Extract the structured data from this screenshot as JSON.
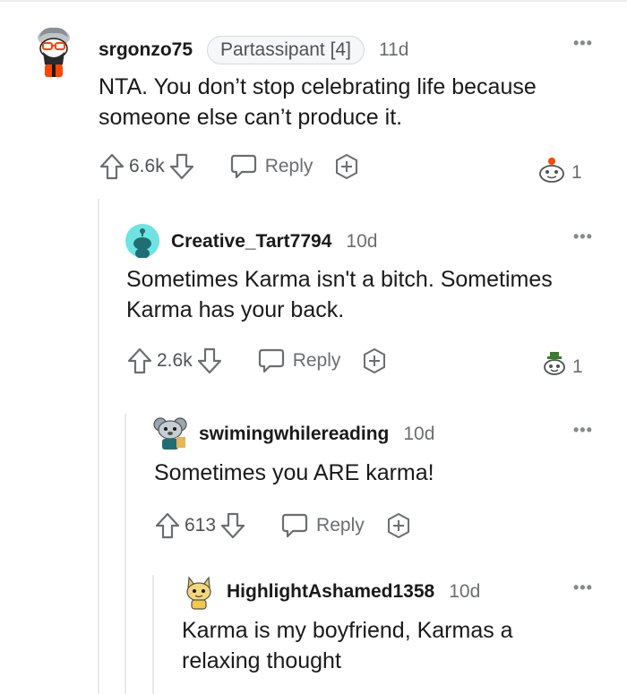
{
  "comments": [
    {
      "username": "srgonzo75",
      "flair": "Partassipant [4]",
      "time": "11d",
      "body": "NTA. You don’t stop celebrating life because someone else can’t produce it.",
      "votes": "6.6k",
      "reply_label": "Reply",
      "award_count": "1"
    },
    {
      "username": "Creative_Tart7794",
      "time": "10d",
      "body": "Sometimes Karma isn't a bitch. Sometimes Karma has your back.",
      "votes": "2.6k",
      "reply_label": "Reply",
      "award_count": "1"
    },
    {
      "username": "swimingwhilereading",
      "time": "10d",
      "body": "Sometimes you ARE karma!",
      "votes": "613",
      "reply_label": "Reply"
    },
    {
      "username": "HighlightAshamed1358",
      "time": "10d",
      "body": "Karma is my boyfriend, Karmas a relaxing thought"
    }
  ],
  "more_label": "•••",
  "icons": {
    "upvote": "upvote-icon",
    "downvote": "downvote-icon",
    "reply": "speech-bubble-icon",
    "award": "add-award-icon"
  },
  "colors": {
    "text": "#1a1a1b",
    "meta": "#6b6e70",
    "thread": "#e8e8e8",
    "accent": "#ff4500"
  }
}
